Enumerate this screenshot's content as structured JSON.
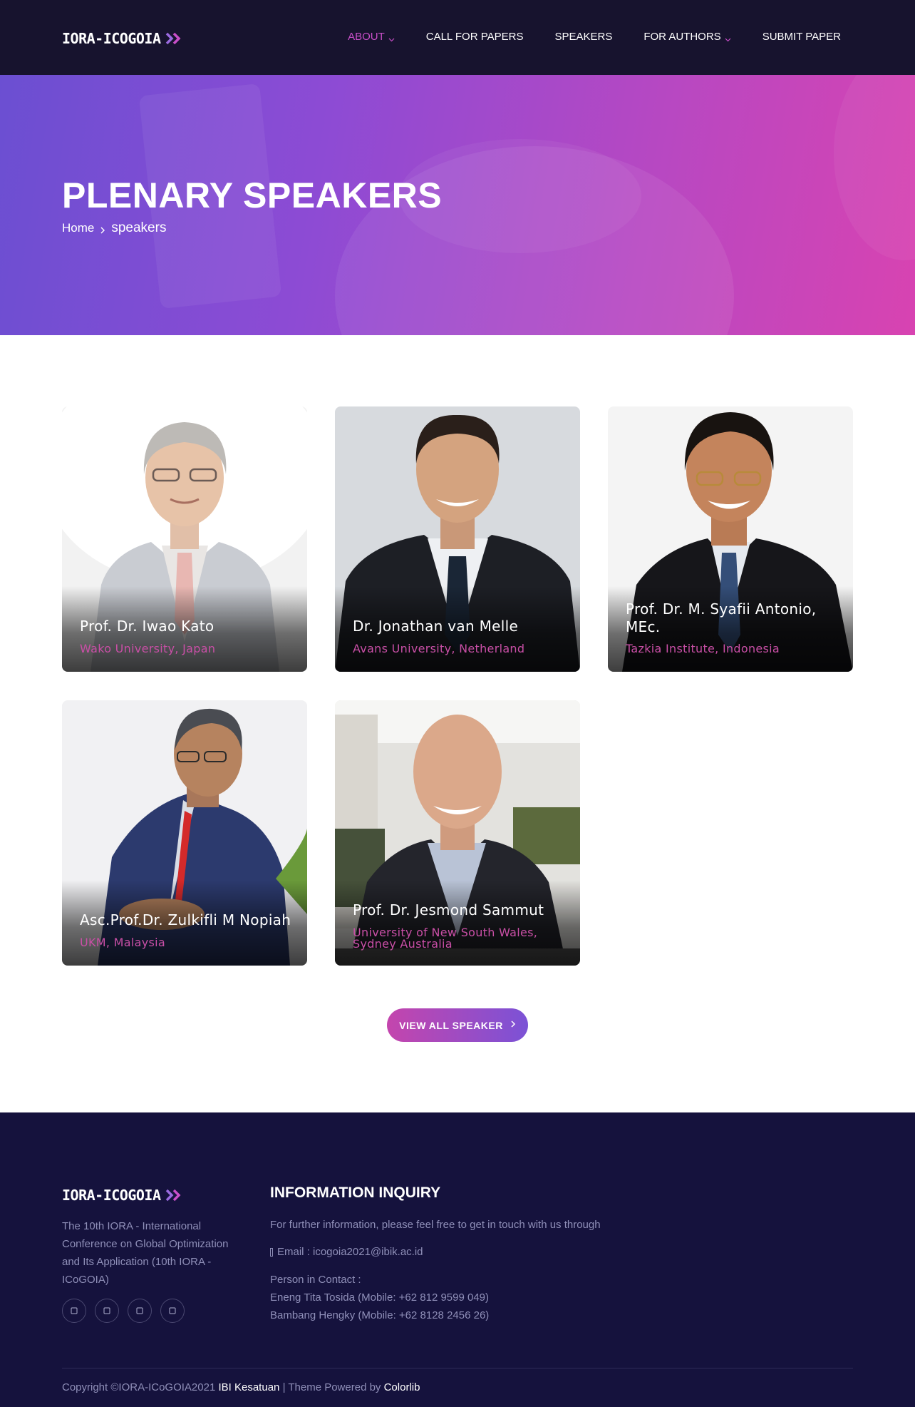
{
  "brand": {
    "logo_text": "IORA-ICOGOIA",
    "accent": "#c94fc9"
  },
  "nav": {
    "items": [
      {
        "label": "ABOUT",
        "has_dropdown": true,
        "active": true
      },
      {
        "label": "CALL FOR PAPERS",
        "has_dropdown": false,
        "active": false
      },
      {
        "label": "SPEAKERS",
        "has_dropdown": false,
        "active": false
      },
      {
        "label": "FOR AUTHORS",
        "has_dropdown": true,
        "active": false
      },
      {
        "label": "SUBMIT PAPER",
        "has_dropdown": false,
        "active": false
      }
    ]
  },
  "hero": {
    "title": "PLENARY SPEAKERS",
    "breadcrumb": {
      "home": "Home",
      "current": "speakers"
    }
  },
  "speakers": [
    {
      "name": "Prof. Dr. Iwao Kato",
      "affiliation": "Wako University, Japan"
    },
    {
      "name": "Dr. Jonathan van Melle",
      "affiliation": "Avans University, Netherland"
    },
    {
      "name": "Prof. Dr. M. Syafii Antonio, MEc.",
      "affiliation": "Tazkia Institute, Indonesia"
    },
    {
      "name": "Asc.Prof.Dr. Zulkifli M Nopiah",
      "affiliation": "UKM, Malaysia"
    },
    {
      "name": "Prof. Dr. Jesmond Sammut",
      "affiliation": "University of New South Wales, Sydney Australia"
    }
  ],
  "view_all_button": {
    "label": "VIEW ALL SPEAKER",
    "icon": "arrow-right-icon"
  },
  "footer": {
    "logo_text": "IORA-ICOGOIA",
    "description": "The 10th IORA - International Conference on Global Optimization and Its Application (10th IORA - ICoGOIA)",
    "socials": [
      {
        "icon": "facebook-icon"
      },
      {
        "icon": "twitter-icon"
      },
      {
        "icon": "instagram-icon"
      },
      {
        "icon": "linkedin-icon"
      }
    ],
    "inquiry": {
      "title": "INFORMATION INQUIRY",
      "intro": "For further information, please feel free to get in touch with us through",
      "email": "Email : icogoia2021@ibik.ac.id",
      "contact_label": "Person in Contact :",
      "contact_1": "Eneng Tita Tosida (Mobile: +62 812 9599 049)",
      "contact_2": "Bambang Hengky (Mobile: +62 8128 2456 26)"
    },
    "copyright": {
      "prefix": "Copyright ©IORA-ICoGOIA2021",
      "org": "IBI Kesatuan",
      "middle": "| Theme Powered by",
      "theme": "Colorlib"
    }
  }
}
